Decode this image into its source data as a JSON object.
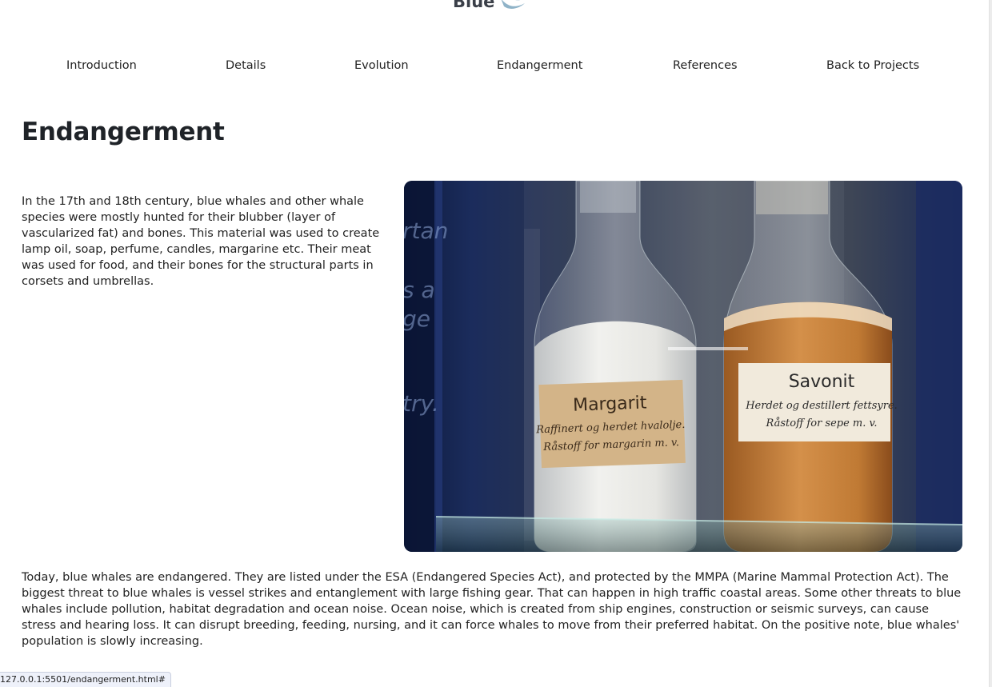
{
  "site": {
    "logo_text": "Blue"
  },
  "nav": {
    "items": [
      {
        "label": "Introduction"
      },
      {
        "label": "Details"
      },
      {
        "label": "Evolution"
      },
      {
        "label": "Endangerment"
      },
      {
        "label": "References"
      },
      {
        "label": "Back to Projects"
      }
    ]
  },
  "page": {
    "title": "Endangerment",
    "paragraph_1": "In the 17th and 18th century, blue whales and other whale species were mostly hunted for their blubber (layer of vascularized fat) and bones. This material was used to create lamp oil, soap, perfume, candles, margarine etc. Their meat was used for food, and their bones for the structural parts in corsets and umbrellas.",
    "paragraph_2": "Today, blue whales are endangered. They are listed under the ESA (Endangered Species Act), and protected by the MMPA (Marine Mammal Protection Act). The biggest threat to blue whales is vessel strikes and entanglement with large fishing gear. That can happen in high traffic coastal areas. Some other threats to blue whales include pollution, habitat degradation and ocean noise. Ocean noise, which is created from ship engines, construction or seismic surveys, can cause stress and hearing loss. It can disrupt breeding, feeding, nursing, and it can force whales to move from their preferred habitat. On the positive note, blue whales' population is slowly increasing."
  },
  "photo": {
    "bg_text": [
      "rtan",
      "s a",
      "ge",
      "try."
    ],
    "jar_left": {
      "title": "Margarit",
      "line1": "Raffinert og herdet hvalolje.",
      "line2": "Råstoff for margarin m. v."
    },
    "jar_right": {
      "title": "Savonit",
      "line1": "Herdet og destillert fettsyre.",
      "line2": "Råstoff for sepe m. v."
    }
  },
  "status": {
    "url": "127.0.0.1:5501/endangerment.html#"
  },
  "colors": {
    "text": "#222222",
    "heading": "#1f2328",
    "logo": "#3a3f48",
    "logo_accent": "#8fb3c8"
  }
}
